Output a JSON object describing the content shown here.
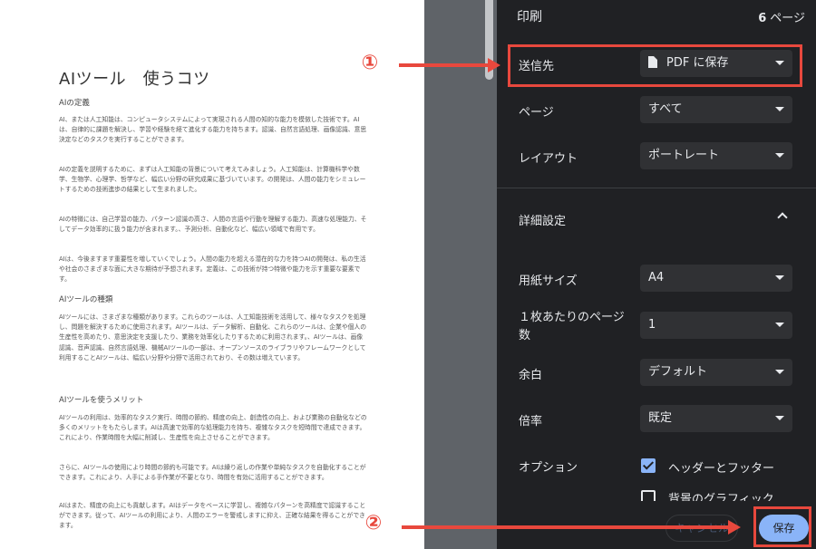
{
  "preview": {
    "document": {
      "title": "AIツール　使うコツ",
      "section1_heading": "AIの定義",
      "p1": "AI、または人工知能は、コンピュータシステムによって実現される人間の知的な能力を模倣した技術です。AIは、自律的に課題を解決し、学習や経験を経て進化する能力を持ちます。認識、自然言語処理、画像認識、意思決定などのタスクを実行することができます。",
      "p2": "AIの定義を説明するために、まずは人工知能の背景について考えてみましょう。人工知能は、計算機科学や数学、生物学、心理学、哲学など、幅広い分野の研究成果に基づいています。の開発は、人間の能力をシミュレートするための技術進歩の結果として生まれました。",
      "p3": "AIの特徴には、自己学習の能力、パターン認識の高さ、人間の言語や行動を理解する能力、高速な処理能力、そしてデータ効率的に扱う能力が含まれます。、予測分析、自動化など、幅広い領域で有用です。",
      "p4": "AIは、今後ますます重要性を増していくでしょう。人間の能力を超える潜在的な力を持つAIの開発は、私の生活や社会のさまざまな面に大きな期待が予想されます。定義は、この技術が持つ特徴や能力を示す重要な要素です。",
      "section2_heading": "AIツールの種類",
      "p5": "AIツールには、さまざまな種類があります。これらのツールは、人工知能技術を活用して、様々なタスクを処理し、問題を解決するために使用されます。AIツールは、データ解析、自動化、これらのツールは、企業や個人の生産性を高めたり、意思決定を支援したり、業務を効率化したりするために利用されます。、AIツールは、画像認識、音声認識、自然言語処理、機械AIツールの一部は、オープンソースのライブラリやフレームワークとして利用することAIツールは、幅広い分野や分野で活用されており、その数は増えています。",
      "section3_heading": "AIツールを使うメリット",
      "p6": "AIツールの利用は、効率的なタスク実行、時間の節約、精度の向上、創造性の向上、および業務の自動化などの多くのメリットをもたらします。AIは高速で効率的な処理能力を持ち、複雑なタスクを短時間で達成できます。これにより、作業時間を大幅に削減し、生産性を向上させることができます。",
      "p7": "さらに、AIツールの使用により時間の節約も可能です。AIは繰り返しの作業や単純なタスクを自動化することができます。これにより、人手による手作業が不要となり、時間を有効に活用することができます。",
      "p8": "AIはまた、精度の向上にも貢献します。AIはデータをベースに学習し、複雑なパターンを高精度で認識することができます。従って、AIツールの利用により、人間のエラーを警戒しますに抑え、正確な結果を得ることができます。"
    }
  },
  "panel": {
    "title": "印刷",
    "page_count_number": "6",
    "page_count_unit": "ページ",
    "destination": {
      "label": "送信先",
      "value": "PDF に保存"
    },
    "pages": {
      "label": "ページ",
      "value": "すべて"
    },
    "layout": {
      "label": "レイアウト",
      "value": "ポートレート"
    },
    "more_settings": {
      "label": "詳細設定"
    },
    "paper_size": {
      "label": "用紙サイズ",
      "value": "A4"
    },
    "pages_per_sheet": {
      "label": "１枚あたりのページ数",
      "value": "1"
    },
    "margins": {
      "label": "余白",
      "value": "デフォルト"
    },
    "scale": {
      "label": "倍率",
      "value": "既定"
    },
    "options": {
      "label": "オプション",
      "headers_footers": {
        "label": "ヘッダーとフッター",
        "checked": true
      },
      "background_graphics": {
        "label": "背景のグラフィック",
        "checked": false
      }
    },
    "cancel_label": "キャンセル",
    "save_label": "保存"
  },
  "annotations": {
    "step1": "①",
    "step2": "②",
    "color": "#e8483d"
  },
  "colors": {
    "panel_bg": "#202124",
    "control_bg": "#303134",
    "accent": "#8ab4f8",
    "preview_bg": "#5f6368"
  }
}
